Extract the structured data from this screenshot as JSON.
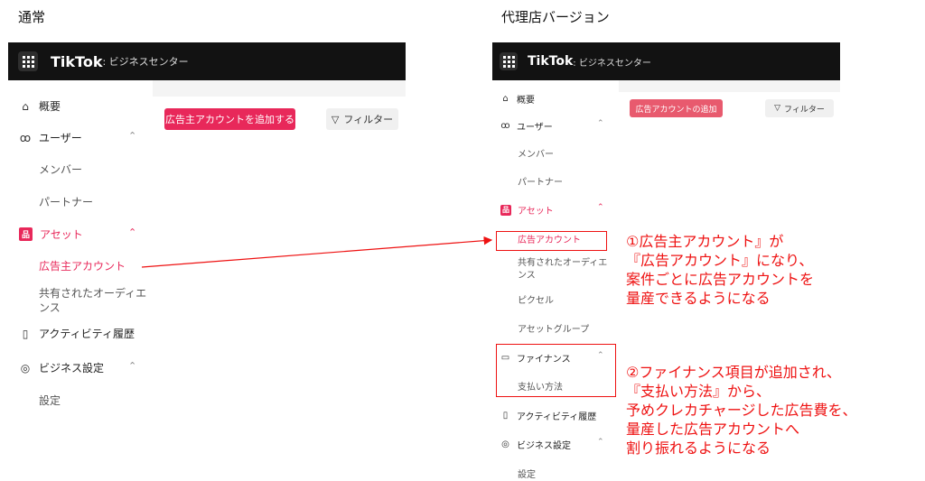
{
  "headings": {
    "left": "通常",
    "right": "代理店バージョン"
  },
  "left_panel": {
    "brand": "TikTok",
    "brand_sub": ": ビジネスセンター",
    "sidebar": {
      "overview": "概要",
      "users": "ユーザー",
      "members": "メンバー",
      "partners": "パートナー",
      "assets": "アセット",
      "ad_accounts": "広告主アカウント",
      "shared_audiences": "共有されたオーディエンス",
      "activity": "アクティビティ履歴",
      "biz_settings": "ビジネス設定",
      "settings": "設定"
    },
    "add_button": "広告主アカウントを追加する",
    "filter_button": "フィルター"
  },
  "right_panel": {
    "brand": "TikTok",
    "brand_sub": ": ビジネスセンター",
    "sidebar": {
      "overview": "概要",
      "users": "ユーザー",
      "members": "メンバー",
      "partners": "パートナー",
      "assets": "アセット",
      "ad_accounts": "広告アカウント",
      "shared_audiences": "共有されたオーディエンス",
      "pixel": "ピクセル",
      "asset_groups": "アセットグループ",
      "finance": "ファイナンス",
      "payment_methods": "支払い方法",
      "activity": "アクティビティ履歴",
      "biz_settings": "ビジネス設定",
      "settings": "設定"
    },
    "add_button": "広告アカウントの追加",
    "filter_button": "フィルター"
  },
  "annotations": {
    "note1": "①広告主アカウント』が\n『広告アカウント』になり、\n案件ごとに広告アカウントを\n量産できるようになる",
    "note2": "②ファイナンス項目が追加され、\n『支払い方法』から、\n予めクレカチャージした広告費を、\n量産した広告アカウントへ\n割り振れるようになる"
  },
  "colors": {
    "accent": "#e8285a",
    "annotation": "#ee1111",
    "topbar": "#121212"
  }
}
